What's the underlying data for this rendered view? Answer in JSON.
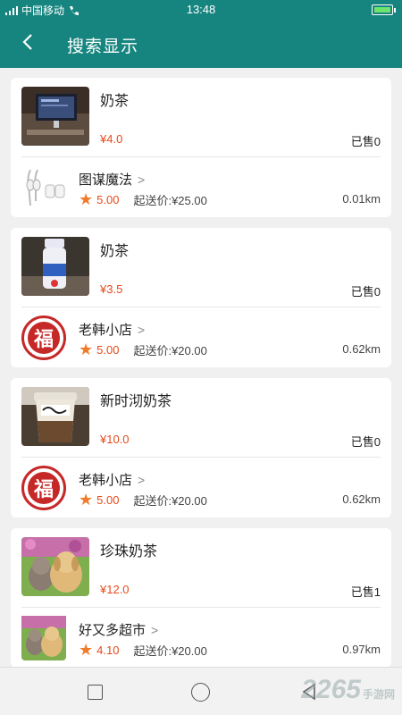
{
  "statusbar": {
    "carrier": "中国移动",
    "time": "13:48"
  },
  "appbar": {
    "back_icon": "chevron-left-icon",
    "title": "搜索显示"
  },
  "results": [
    {
      "product": {
        "name": "奶茶",
        "price": "¥4.0",
        "sold": "已售0"
      },
      "shop": {
        "name": "图谋魔法",
        "rating": "5.00",
        "min_fee": "起送价:¥25.00",
        "distance": "0.01km"
      }
    },
    {
      "product": {
        "name": "奶茶",
        "price": "¥3.5",
        "sold": "已售0"
      },
      "shop": {
        "name": "老韩小店",
        "rating": "5.00",
        "min_fee": "起送价:¥20.00",
        "distance": "0.62km"
      }
    },
    {
      "product": {
        "name": "新时沏奶茶",
        "price": "¥10.0",
        "sold": "已售0"
      },
      "shop": {
        "name": "老韩小店",
        "rating": "5.00",
        "min_fee": "起送价:¥20.00",
        "distance": "0.62km"
      }
    },
    {
      "product": {
        "name": "珍珠奶茶",
        "price": "¥12.0",
        "sold": "已售1"
      },
      "shop": {
        "name": "好又多超市",
        "rating": "4.10",
        "min_fee": "起送价:¥20.00",
        "distance": "0.97km"
      }
    }
  ],
  "seal_char": "福",
  "watermark": {
    "number": "2265",
    "site": "手游网"
  },
  "colors": {
    "primary": "#17857f",
    "price": "#e64a19",
    "star": "#f07b2a"
  }
}
